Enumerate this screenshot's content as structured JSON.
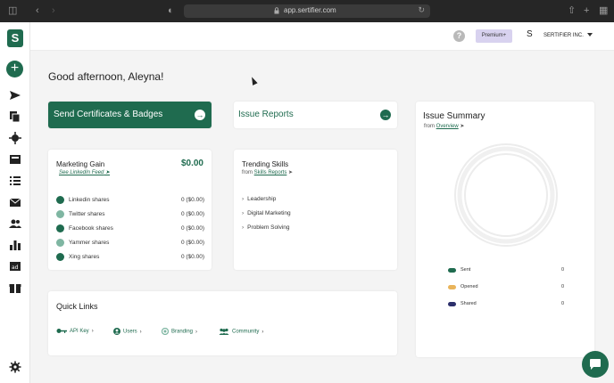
{
  "browser": {
    "url": "app.sertifier.com"
  },
  "app": {
    "logo_letter": "S"
  },
  "header": {
    "help_label": "?",
    "premium_label": "Premium+",
    "user_initial": "S",
    "company_name": "SERTIFIER INC."
  },
  "greeting": "Good afternoon, Aleyna!",
  "actions": {
    "send_label": "Send Certificates & Badges",
    "issue_reports_label": "Issue Reports"
  },
  "marketing_gain": {
    "title": "Marketing Gain",
    "amount": "$0.00",
    "link": "See LinkedIn Feed",
    "rows": [
      {
        "label": "Linkedin shares",
        "value": "0 ($0.00)",
        "icon": "linkedin-icon",
        "color": "#1f6b4f"
      },
      {
        "label": "Twitter shares",
        "value": "0 ($0.00)",
        "icon": "twitter-icon",
        "color": "#7fb6a2"
      },
      {
        "label": "Facebook shares",
        "value": "0 ($0.00)",
        "icon": "facebook-icon",
        "color": "#1f6b4f"
      },
      {
        "label": "Yammer shares",
        "value": "0 ($0.00)",
        "icon": "yammer-icon",
        "color": "#7fb6a2"
      },
      {
        "label": "Xing shares",
        "value": "0 ($0.00)",
        "icon": "xing-icon",
        "color": "#1f6b4f"
      }
    ]
  },
  "trending_skills": {
    "title": "Trending Skills",
    "from_prefix": "from",
    "from_link": "Skills Reports",
    "skills": [
      "Leadership",
      "Digital Marketing",
      "Problem Solving"
    ]
  },
  "issue_summary": {
    "title": "Issue Summary",
    "from_prefix": "from",
    "from_link": "Overview",
    "legend": [
      {
        "label": "Sent",
        "value": "0",
        "color": "#1f6b4f"
      },
      {
        "label": "Opened",
        "value": "0",
        "color": "#e9b45a"
      },
      {
        "label": "Shared",
        "value": "0",
        "color": "#2c2f6b"
      }
    ]
  },
  "quick_links": {
    "title": "Quick Links",
    "items": [
      {
        "label": "API Key",
        "icon": "key-icon"
      },
      {
        "label": "Users",
        "icon": "user-icon"
      },
      {
        "label": "Branding",
        "icon": "branding-icon"
      },
      {
        "label": "Community",
        "icon": "community-icon"
      }
    ]
  },
  "colors": {
    "brand": "#1f6b4f",
    "premium_bg": "#d8d2ef"
  }
}
